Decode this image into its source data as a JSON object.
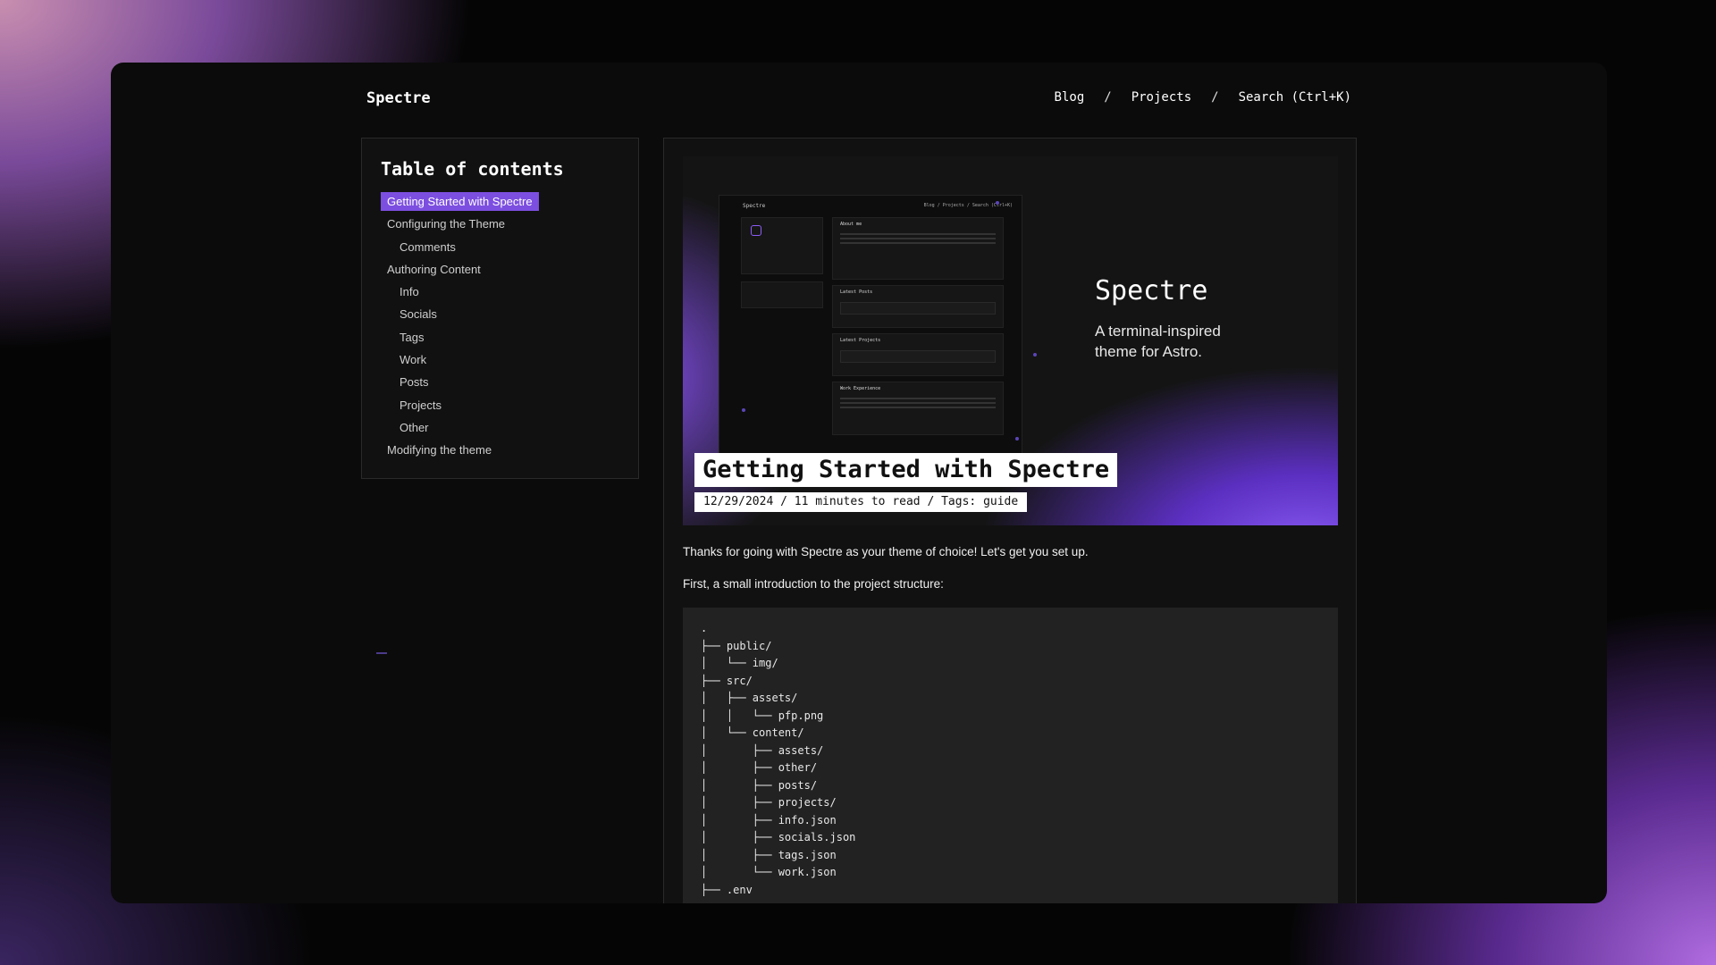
{
  "site": {
    "brand": "Spectre",
    "nav": [
      "Blog",
      "Projects",
      "Search (Ctrl+K)"
    ],
    "separator": "/"
  },
  "toc": {
    "heading": "Table of contents",
    "items": [
      {
        "label": "Getting Started with Spectre",
        "level": 1,
        "active": true
      },
      {
        "label": "Configuring the Theme",
        "level": 1,
        "active": false
      },
      {
        "label": "Comments",
        "level": 2,
        "active": false
      },
      {
        "label": "Authoring Content",
        "level": 1,
        "active": false
      },
      {
        "label": "Info",
        "level": 2,
        "active": false
      },
      {
        "label": "Socials",
        "level": 2,
        "active": false
      },
      {
        "label": "Tags",
        "level": 2,
        "active": false
      },
      {
        "label": "Work",
        "level": 2,
        "active": false
      },
      {
        "label": "Posts",
        "level": 2,
        "active": false
      },
      {
        "label": "Projects",
        "level": 2,
        "active": false
      },
      {
        "label": "Other",
        "level": 2,
        "active": false
      },
      {
        "label": "Modifying the theme",
        "level": 1,
        "active": false
      }
    ]
  },
  "hero": {
    "mock": {
      "brand": "Spectre",
      "nav": "Blog / Projects / Search (Ctrl+K)",
      "cards": [
        "About me",
        "Latest Posts",
        "Latest Projects",
        "Work Experience"
      ]
    },
    "title": "Spectre",
    "subtitle": "A terminal-inspired theme for Astro."
  },
  "post": {
    "title": "Getting Started with Spectre",
    "meta": "12/29/2024 / 11 minutes to read / Tags: guide",
    "intro": "Thanks for going with Spectre as your theme of choice! Let's get you set up.",
    "structure_intro": "First, a small introduction to the project structure:",
    "code": ".\n├── public/\n│   └── img/\n├── src/\n│   ├── assets/\n│   │   └── pfp.png\n│   └── content/\n│       ├── assets/\n│       ├── other/\n│       ├── posts/\n│       ├── projects/\n│       ├── info.json\n│       ├── socials.json\n│       ├── tags.json\n│       └── work.json\n├── .env"
  },
  "colors": {
    "accent": "#7c4fe0",
    "panel": "#111111",
    "code_bg": "#222222"
  }
}
